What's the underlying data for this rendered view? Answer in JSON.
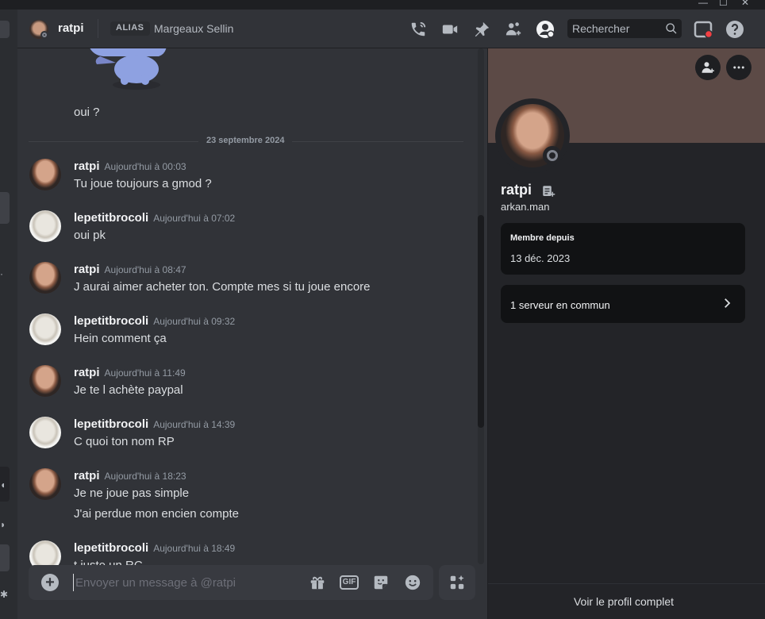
{
  "window": {
    "minimize": "—",
    "maximize": "☐",
    "close": "✕"
  },
  "header": {
    "title": "ratpi",
    "alias_badge": "ALIAS",
    "alias_name": "Margeaux Sellin",
    "search_placeholder": "Rechercher",
    "icons": [
      "voice-call-icon",
      "video-call-icon",
      "pin-icon",
      "add-friend-icon",
      "user-profile-icon",
      "search-icon",
      "inbox-icon",
      "help-icon"
    ],
    "inbox_dot_color": "#f23f43"
  },
  "chat": {
    "prev_tail": "oui ?",
    "date_divider": "23 septembre 2024",
    "messages": [
      {
        "author": "ratpi",
        "time": "Aujourd'hui à 00:03",
        "lines": [
          "Tu joue toujours a gmod ?"
        ]
      },
      {
        "author": "lepetitbrocoli",
        "time": "Aujourd'hui à 07:02",
        "lines": [
          "oui pk"
        ]
      },
      {
        "author": "ratpi",
        "time": "Aujourd'hui à 08:47",
        "lines": [
          "J aurai aimer acheter ton. Compte mes si tu joue encore"
        ]
      },
      {
        "author": "lepetitbrocoli",
        "time": "Aujourd'hui à 09:32",
        "lines": [
          "Hein comment ça"
        ]
      },
      {
        "author": "ratpi",
        "time": "Aujourd'hui à 11:49",
        "lines": [
          "Je te l achète paypal"
        ]
      },
      {
        "author": "lepetitbrocoli",
        "time": "Aujourd'hui à 14:39",
        "lines": [
          "C quoi ton nom RP"
        ]
      },
      {
        "author": "ratpi",
        "time": "Aujourd'hui à 18:23",
        "lines": [
          "Je ne joue pas simple",
          "J'ai perdue mon encien compte"
        ]
      },
      {
        "author": "lepetitbrocoli",
        "time": "Aujourd'hui à 18:49",
        "lines": [
          "t juste un RC"
        ]
      }
    ]
  },
  "composer": {
    "placeholder": "Envoyer un message à @ratpi",
    "gif_label": "GIF"
  },
  "profile": {
    "display_name": "ratpi",
    "username": "arkan.man",
    "member_since_label": "Membre depuis",
    "member_since_value": "13 déc. 2023",
    "mutual_servers": "1 serveur en commun",
    "footer_link": "Voir le profil complet",
    "banner_color": "#5c4a46"
  }
}
